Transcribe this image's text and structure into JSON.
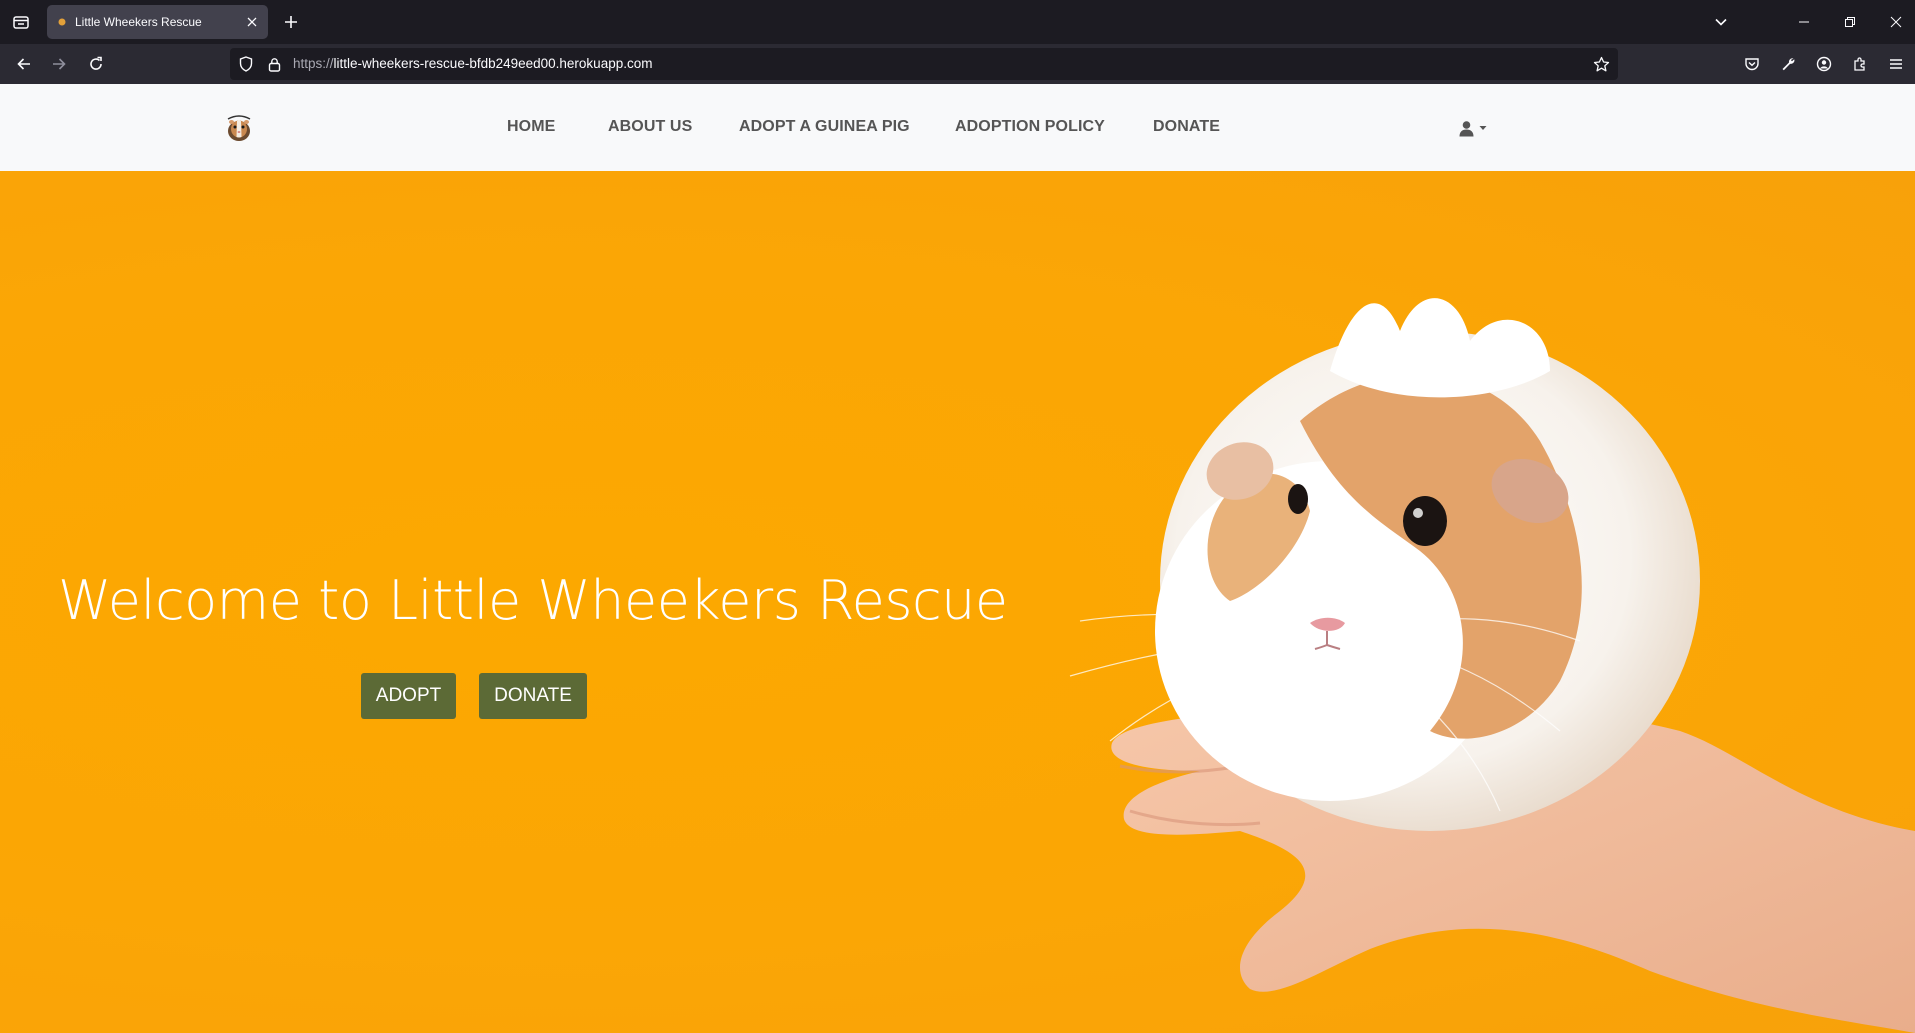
{
  "browser": {
    "tab": {
      "title": "Little Wheekers Rescue"
    },
    "url": {
      "scheme": "https://",
      "host": "little-wheekers-rescue-bfdb249eed00.herokuapp.com"
    }
  },
  "site": {
    "nav": {
      "items": [
        {
          "label": "HOME"
        },
        {
          "label": "ABOUT US"
        },
        {
          "label": "ADOPT A GUINEA PIG"
        },
        {
          "label": "ADOPTION POLICY"
        },
        {
          "label": "DONATE"
        }
      ]
    },
    "hero": {
      "title": "Welcome to Little Wheekers Rescue",
      "adopt_label": "ADOPT",
      "donate_label": "DONATE"
    }
  },
  "colors": {
    "hero_background": "#fba703",
    "button": "#5c6a36",
    "nav_background": "#f8f9fa",
    "nav_text": "#555555"
  }
}
